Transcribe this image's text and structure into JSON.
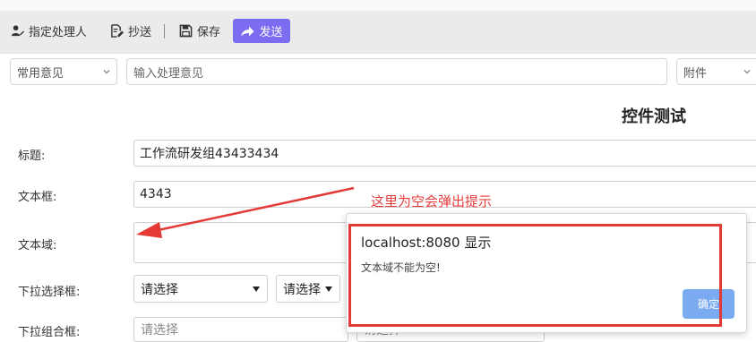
{
  "toolbar": {
    "assign_label": "指定处理人",
    "cc_label": "抄送",
    "save_label": "保存",
    "send_label": "发送"
  },
  "opinion": {
    "common_placeholder": "常用意见",
    "input_placeholder": "输入处理意见",
    "attachment_label": "附件"
  },
  "form": {
    "title": "控件测试",
    "fields": {
      "title_label": "标题:",
      "title_value": "工作流研发组43433434",
      "textbox_label": "文本框:",
      "textbox_value": "4343",
      "textarea_label": "文本域:",
      "dropdown_label": "下拉选择框:",
      "dropdown1_value": "请选择",
      "dropdown2_value": "请选择",
      "combo_label": "下拉组合框:",
      "combo_value": "请选择",
      "combo2_value": "请选择"
    }
  },
  "annotation": {
    "text": "这里为空会弹出提示",
    "color": "#e83c3c"
  },
  "dialog": {
    "title": "localhost:8080 显示",
    "message": "文本域不能为空!",
    "ok_label": "确定"
  },
  "colors": {
    "send_button": "#7c6cf2",
    "ok_button": "#7aabf0",
    "highlight_box": "#e53935"
  }
}
